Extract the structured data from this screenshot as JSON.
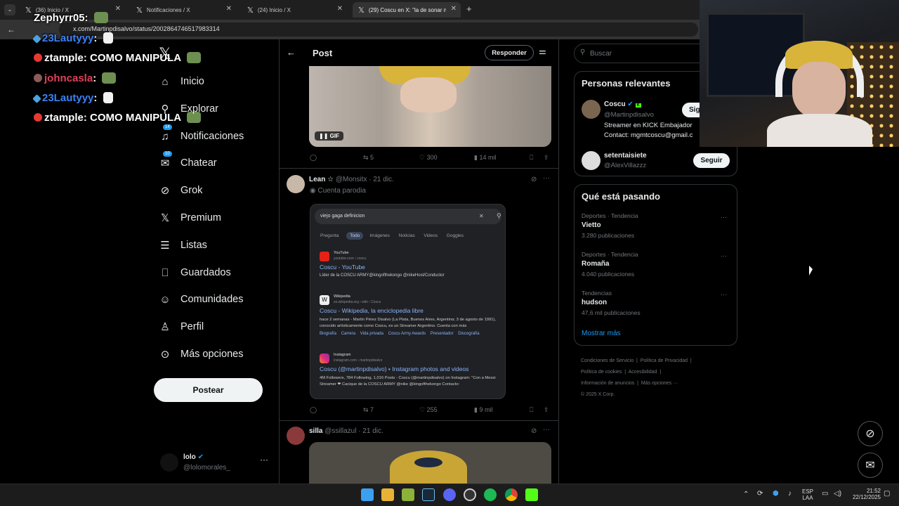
{
  "browser": {
    "tabs": [
      {
        "title": "(36) Inicio / X"
      },
      {
        "title": "Notificaciones / X"
      },
      {
        "title": "(24) Inicio / X"
      },
      {
        "title": "(29) Coscu en X: \"la de sonar m"
      }
    ],
    "url": "x.com/Martinpdisalvo/status/2002864746517983314"
  },
  "chat": [
    {
      "user": "Zephyrr05",
      "color": "#ffffff"
    },
    {
      "user": "23Lautyyy",
      "color": "#3b82f6"
    },
    {
      "user": "ztample",
      "message": "COMO MANIPULA",
      "color": "#ffffff"
    },
    {
      "user": "johncasla",
      "color": "#e0405a"
    },
    {
      "user": "23Lautyyy",
      "color": "#3b82f6"
    },
    {
      "user": "ztample",
      "message": "COMO MANIPULA",
      "color": "#ffffff"
    }
  ],
  "nav": {
    "items": [
      {
        "label": "Inicio",
        "icon": "home-icon"
      },
      {
        "label": "Explorar",
        "icon": "search-icon"
      },
      {
        "label": "Notificaciones",
        "icon": "bell-icon",
        "badge": "14"
      },
      {
        "label": "Chatear",
        "icon": "mail-icon",
        "badge": "10"
      },
      {
        "label": "Grok",
        "icon": "grok-icon"
      },
      {
        "label": "Premium",
        "icon": "x-logo-icon"
      },
      {
        "label": "Listas",
        "icon": "list-icon"
      },
      {
        "label": "Guardados",
        "icon": "bookmark-icon"
      },
      {
        "label": "Comunidades",
        "icon": "communities-icon"
      },
      {
        "label": "Perfil",
        "icon": "person-icon"
      },
      {
        "label": "Más opciones",
        "icon": "more-icon"
      }
    ],
    "post_button": "Postear",
    "account": {
      "name": "lolo",
      "handle": "@lolomorales_"
    }
  },
  "header": {
    "title": "Post",
    "reply_button": "Responder"
  },
  "posts": [
    {
      "gif_label": "GIF",
      "retweets": "5",
      "likes": "300",
      "views": "14 mil"
    },
    {
      "author": "Lean",
      "author_suffix": "☆",
      "handle": "@Monsitx",
      "date": "· 21 dic.",
      "parody_label": "Cuenta parodia",
      "retweets": "7",
      "likes": "255",
      "views": "9 mil",
      "search_image": {
        "query": "viejo gaga definicion",
        "tabs": [
          "Pregunta",
          "Todo",
          "Imágenes",
          "Noticias",
          "Videos",
          "Goggles"
        ],
        "results": [
          {
            "site": "YouTube",
            "source": "youtube.com › coscu",
            "title": "Coscu - YouTube",
            "desc": "Líder de la COSCU ARMY@kingofthekongo @nikeHost/Conductor"
          },
          {
            "site": "Wikipedia",
            "source": "es.wikipedia.org › wiki › Coscu",
            "title": "Coscu - Wikipedia, la enciclopedia libre",
            "desc": "hace 2 semanas - Martín Pérez Disalvo (La Plata, Buenos Aires, Argentina; 3 de agosto de 1991), conocido artísticamente como Coscu, es un Streamer Argentino. Cuenta con más",
            "links": [
              "Biografía",
              "Carrera",
              "Vida privada",
              "Coscu Army Awards",
              "Presentador",
              "Discografía"
            ]
          },
          {
            "site": "Instagram",
            "source": "instagram.com › martinpdisalvo",
            "title": "Coscu (@martinpdisalvo) • Instagram photos and videos",
            "desc": "4M Followers, 784 Following, 1,016 Posts - Coscu (@martinpdisalvo) on Instagram: \"Con a Messi Streamer ❤ Cacique de la COSCU ARMY @nike @kingofthekongo Contacto:"
          }
        ]
      }
    },
    {
      "author": "silla",
      "handle": "@ssillazul",
      "date": "· 21 dic."
    }
  ],
  "search": {
    "placeholder": "Buscar"
  },
  "relevant": {
    "title": "Personas relevantes",
    "people": [
      {
        "name": "Coscu",
        "handle": "@Martinpdisalvo",
        "bio": "Streamer en KICK Embajador",
        "bio2": "Contact: mgmtcoscu@gmail.c",
        "button": "Sig"
      },
      {
        "name": "setentaisiete",
        "handle": "@AlexVillazzz",
        "button": "Seguir"
      }
    ]
  },
  "trends": {
    "title": "Qué está pasando",
    "items": [
      {
        "context": "Deportes · Tendencia",
        "name": "Vietto",
        "count": "3.280 publicaciones"
      },
      {
        "context": "Deportes · Tendencia",
        "name": "Romaña",
        "count": "4.040 publicaciones"
      },
      {
        "context": "Tendencias",
        "name": "hudson",
        "count": "47,6 mil publicaciones"
      }
    ],
    "more": "Mostrar más"
  },
  "footer": {
    "links": [
      "Condiciones de Servicio",
      "Política de Privacidad",
      "Política de cookies",
      "Accesibilidad",
      "Información de anuncios",
      "Más opciones ···"
    ],
    "copyright": "© 2025 X Corp."
  },
  "taskbar": {
    "lang": "ESP",
    "lang2": "LAA",
    "time": "21:52",
    "date": "22/12/2025"
  },
  "colors": {
    "accent": "#1d9bf0",
    "background": "#000000",
    "border": "#2f3336",
    "muted": "#71767b"
  }
}
